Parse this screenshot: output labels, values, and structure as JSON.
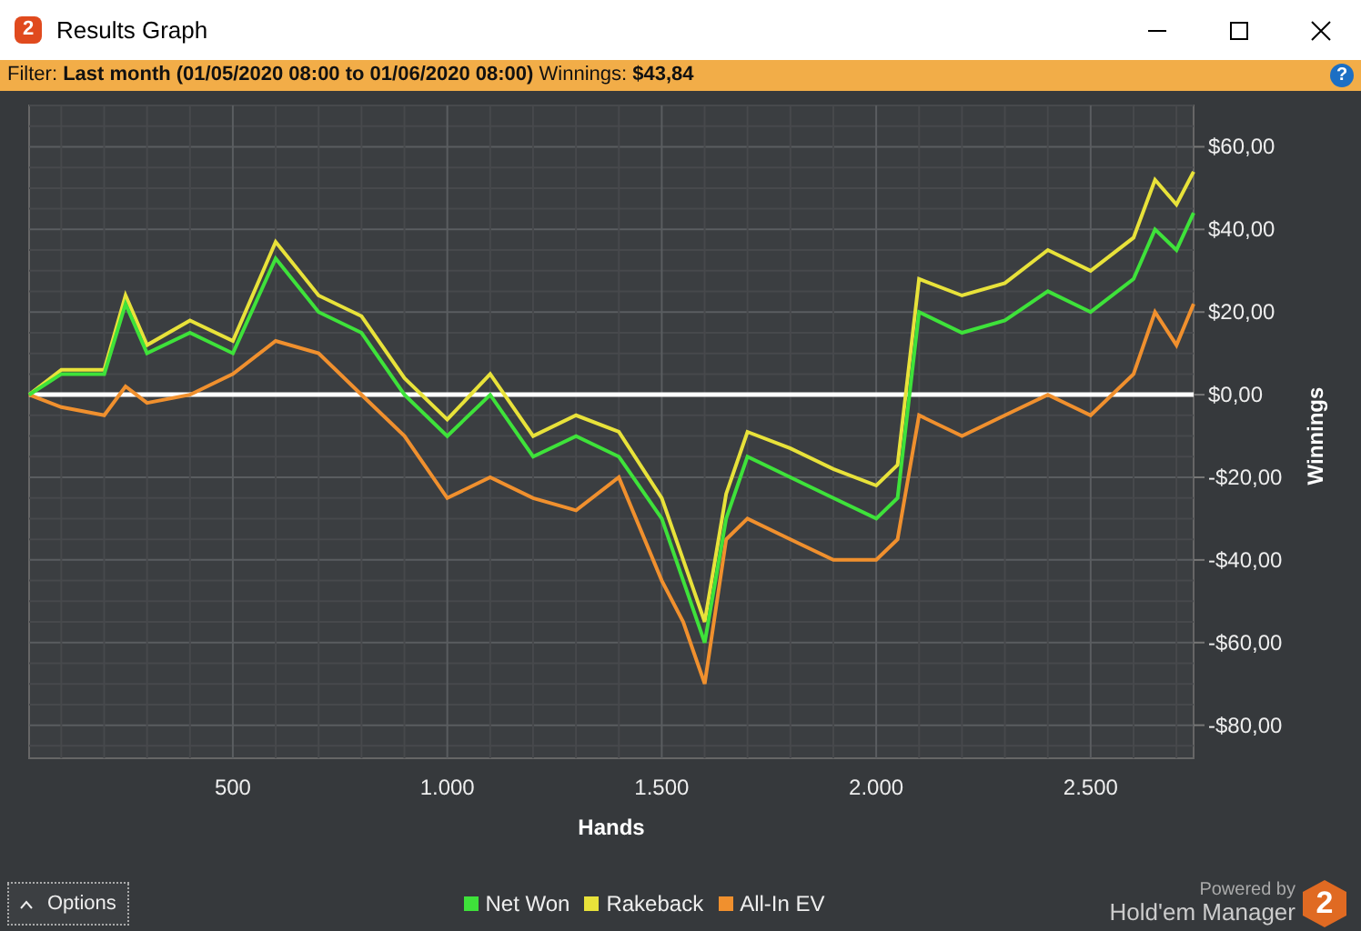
{
  "window": {
    "title": "Results Graph",
    "icon_text": "2"
  },
  "filter": {
    "text": "Filter: **Last month (01/05/2020 08:00 to 01/06/2020 08:00)** Winnings: **$43,84**",
    "help_glyph": "?"
  },
  "chart": {
    "chart_data": {
      "type": "line",
      "xlabel": "Hands",
      "ylabel": "Winnings",
      "x": [
        25,
        100,
        200,
        250,
        300,
        400,
        500,
        600,
        700,
        800,
        900,
        1000,
        1100,
        1200,
        1300,
        1400,
        1500,
        1550,
        1600,
        1650,
        1700,
        1800,
        1900,
        2000,
        2050,
        2100,
        2200,
        2300,
        2400,
        2500,
        2600,
        2650,
        2700,
        2740
      ],
      "series": [
        {
          "name": "Net Won",
          "color": "#3ee23a",
          "values": [
            0,
            5,
            5,
            22,
            10,
            15,
            10,
            33,
            20,
            15,
            0,
            -10,
            0,
            -15,
            -10,
            -15,
            -30,
            -45,
            -60,
            -30,
            -15,
            -20,
            -25,
            -30,
            -25,
            20,
            15,
            18,
            25,
            20,
            28,
            40,
            35,
            44
          ]
        },
        {
          "name": "Rakeback",
          "color": "#e8e23a",
          "values": [
            0,
            6,
            6,
            24,
            12,
            18,
            13,
            37,
            24,
            19,
            4,
            -6,
            5,
            -10,
            -5,
            -9,
            -25,
            -40,
            -55,
            -24,
            -9,
            -13,
            -18,
            -22,
            -17,
            28,
            24,
            27,
            35,
            30,
            38,
            52,
            46,
            54
          ]
        },
        {
          "name": "All-In EV",
          "color": "#f0902e",
          "values": [
            0,
            -3,
            -5,
            2,
            -2,
            0,
            5,
            13,
            10,
            0,
            -10,
            -25,
            -20,
            -25,
            -28,
            -20,
            -45,
            -55,
            -70,
            -35,
            -30,
            -35,
            -40,
            -40,
            -35,
            -5,
            -10,
            -5,
            0,
            -5,
            5,
            20,
            12,
            22
          ]
        }
      ],
      "grid": true,
      "xlim": [
        25,
        2740
      ],
      "ylim": [
        -88,
        70
      ],
      "xticks": [
        {
          "value": 500,
          "label": "500"
        },
        {
          "value": 1000,
          "label": "1.000"
        },
        {
          "value": 1500,
          "label": "1.500"
        },
        {
          "value": 2000,
          "label": "2.000"
        },
        {
          "value": 2500,
          "label": "2.500"
        }
      ],
      "yticks": [
        {
          "value": 60,
          "label": "$60,00"
        },
        {
          "value": 40,
          "label": "$40,00"
        },
        {
          "value": 20,
          "label": "$20,00"
        },
        {
          "value": 0,
          "label": "$0,00"
        },
        {
          "value": -20,
          "label": "-$20,00"
        },
        {
          "value": -40,
          "label": "-$40,00"
        },
        {
          "value": -60,
          "label": "-$60,00"
        },
        {
          "value": -80,
          "label": "-$80,00"
        }
      ]
    }
  },
  "options_button": "Options",
  "branding": {
    "powered_by": "Powered by",
    "product": "Hold'em Manager",
    "logo_text": "2"
  }
}
